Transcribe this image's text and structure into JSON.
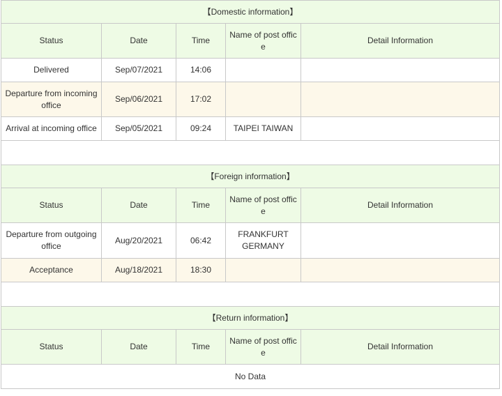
{
  "columns": {
    "status": "Status",
    "date": "Date",
    "time": "Time",
    "post_office": "Name of post office",
    "detail": "Detail Information"
  },
  "domestic": {
    "title": "【Domestic information】",
    "rows": [
      {
        "status": "Delivered",
        "date": "Sep/07/2021",
        "time": "14:06",
        "office": "",
        "detail": ""
      },
      {
        "status": "Departure from incoming office",
        "date": "Sep/06/2021",
        "time": "17:02",
        "office": "",
        "detail": ""
      },
      {
        "status": "Arrival at incoming office",
        "date": "Sep/05/2021",
        "time": "09:24",
        "office": "TAIPEI TAIWAN",
        "detail": ""
      }
    ]
  },
  "foreign": {
    "title": "【Foreign information】",
    "rows": [
      {
        "status": "Departure from outgoing office",
        "date": "Aug/20/2021",
        "time": "06:42",
        "office": "FRANKFURT GERMANY",
        "detail": ""
      },
      {
        "status": "Acceptance",
        "date": "Aug/18/2021",
        "time": "18:30",
        "office": "",
        "detail": ""
      }
    ]
  },
  "return": {
    "title": "【Return information】",
    "no_data": "No Data"
  }
}
